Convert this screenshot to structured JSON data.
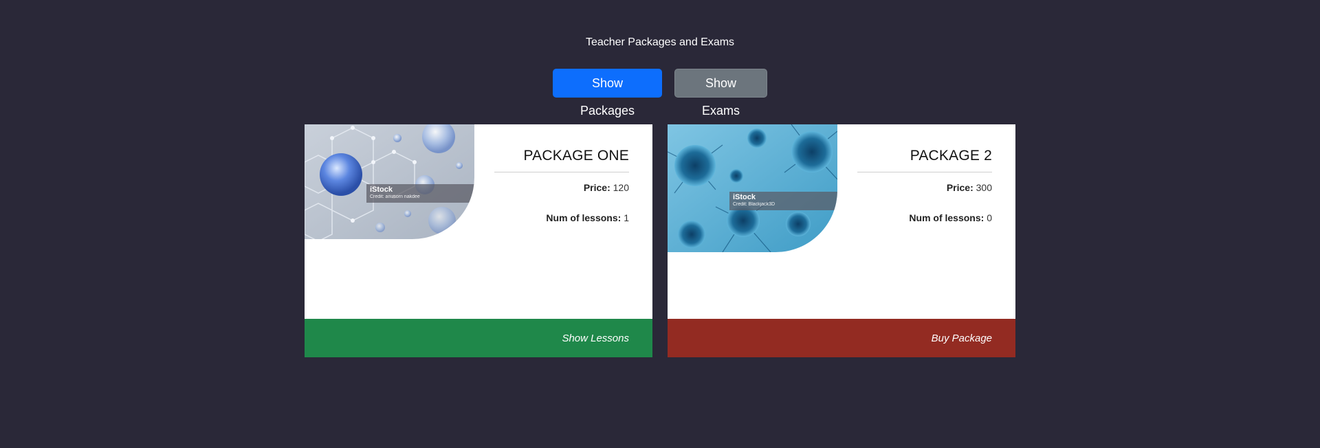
{
  "page": {
    "title": "Teacher Packages and Exams"
  },
  "toolbar": {
    "show_packages_label": "Show Packages",
    "show_exams_label": "Show Exams"
  },
  "colors": {
    "background": "#2a2838",
    "primary_button": "#0d6efd",
    "secondary_button": "#6c757d",
    "footer_show_lessons": "#1f884a",
    "footer_buy_package": "#932b22"
  },
  "packages": [
    {
      "title": "PACKAGE ONE",
      "price_label": "Price:",
      "price": "120",
      "lessons_label": "Num of lessons:",
      "lessons": "1",
      "image": {
        "watermark": "iStock",
        "credit": "Credit: anusorn nakdee",
        "subject": "molecule-bubbles-image"
      },
      "footer_label": "Show Lessons"
    },
    {
      "title": "PACKAGE 2",
      "price_label": "Price:",
      "price": "300",
      "lessons_label": "Num of lessons:",
      "lessons": "0",
      "image": {
        "watermark": "iStock",
        "credit": "Credit: Blackjack3D",
        "subject": "virus-cells-image"
      },
      "footer_label": "Buy Package"
    }
  ]
}
